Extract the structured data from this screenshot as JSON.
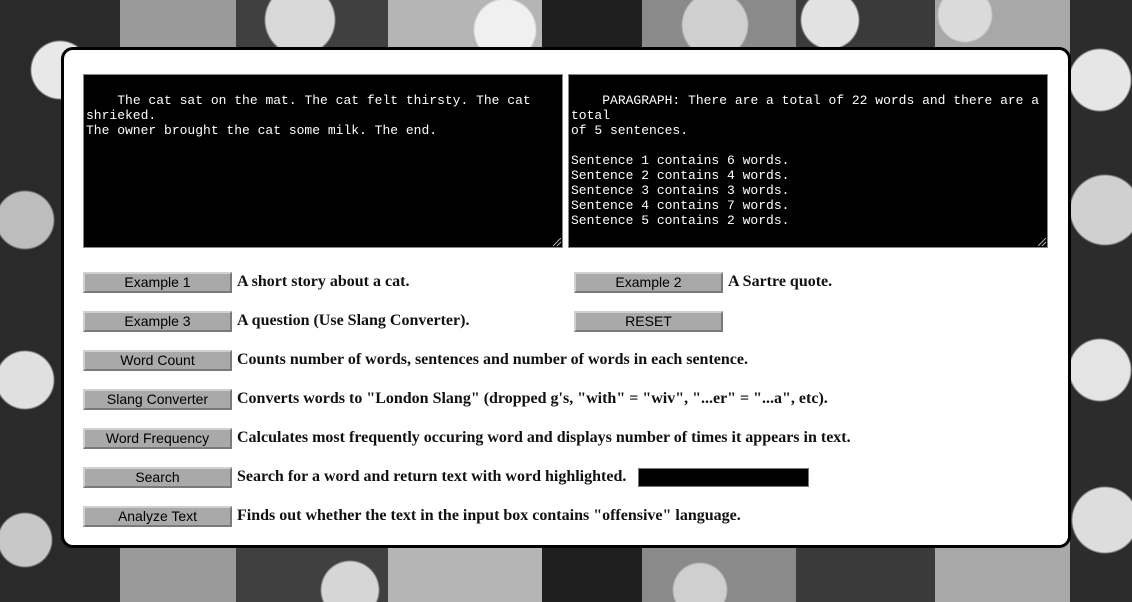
{
  "input_text": "The cat sat on the mat. The cat felt thirsty. The cat shrieked.\nThe owner brought the cat some milk. The end.",
  "output_text": "PARAGRAPH: There are a total of 22 words and there are a total\nof 5 sentences.\n\nSentence 1 contains 6 words.\nSentence 2 contains 4 words.\nSentence 3 contains 3 words.\nSentence 4 contains 7 words.\nSentence 5 contains 2 words.",
  "buttons": {
    "example1": {
      "label": "Example 1",
      "desc": "A short story about a cat."
    },
    "example2": {
      "label": "Example 2",
      "desc": "A Sartre quote."
    },
    "example3": {
      "label": "Example 3",
      "desc": "A question (Use Slang Converter)."
    },
    "reset": {
      "label": "RESET"
    },
    "word_count": {
      "label": "Word Count",
      "desc": "Counts number of words, sentences and number of words in each sentence."
    },
    "slang": {
      "label": "Slang Converter",
      "desc": "Converts words to \"London Slang\" (dropped g's, \"with\" = \"wiv\", \"...er\" = \"...a\", etc)."
    },
    "word_freq": {
      "label": "Word Frequency",
      "desc": "Calculates most frequently occuring word and displays number of times it appears in text."
    },
    "search": {
      "label": "Search",
      "desc": "Search for a word and return text with word highlighted.",
      "input_value": ""
    },
    "analyze": {
      "label": "Analyze Text",
      "desc": "Finds out whether the text in the input box contains \"offensive\" language."
    }
  }
}
